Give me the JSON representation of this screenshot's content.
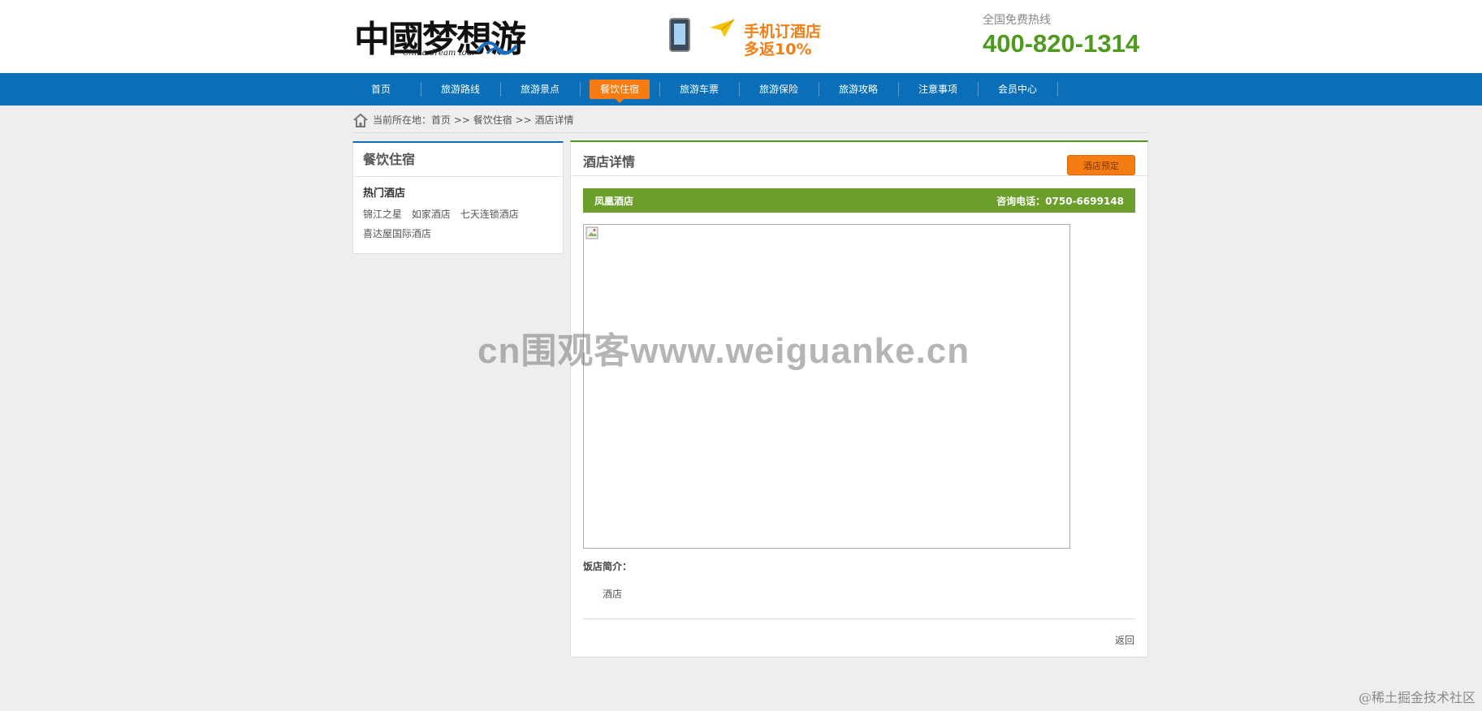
{
  "header": {
    "logo_text": "中國梦想游",
    "logo_subtitle": "China dream tour",
    "promo_line1": "手机订酒店",
    "promo_line2": "多返10%",
    "hotline_label": "全国免费热线",
    "hotline_number": "400-820-1314"
  },
  "nav": {
    "items": [
      {
        "label": "首页"
      },
      {
        "label": "旅游路线"
      },
      {
        "label": "旅游景点"
      },
      {
        "label": "餐饮住宿",
        "active": true
      },
      {
        "label": "旅游车票"
      },
      {
        "label": "旅游保险"
      },
      {
        "label": "旅游攻略"
      },
      {
        "label": "注意事项"
      },
      {
        "label": "会员中心"
      }
    ]
  },
  "breadcrumb": {
    "text": "当前所在地：首页 >> 餐饮住宿 >> 酒店详情"
  },
  "sidebar": {
    "title": "餐饮住宿",
    "section_title": "热门酒店",
    "hotels": [
      "锦江之星",
      "如家酒店",
      "七天连锁酒店",
      "喜达屋国际酒店"
    ]
  },
  "main": {
    "title": "酒店详情",
    "book_button": "酒店预定",
    "hotel_name": "凤凰酒店",
    "phone": "咨询电话：0750-6699148",
    "intro_label": "饭店简介：",
    "intro_text": "酒店",
    "back_link": "返回"
  },
  "watermark": "cn围观客www.weiguanke.cn",
  "corner_credit": "@稀土掘金技术社区",
  "colors": {
    "nav_blue": "#0a6fb8",
    "active_orange": "#f67b12",
    "accent_green": "#4e9a1e",
    "bar_green": "#6b9e2b"
  }
}
